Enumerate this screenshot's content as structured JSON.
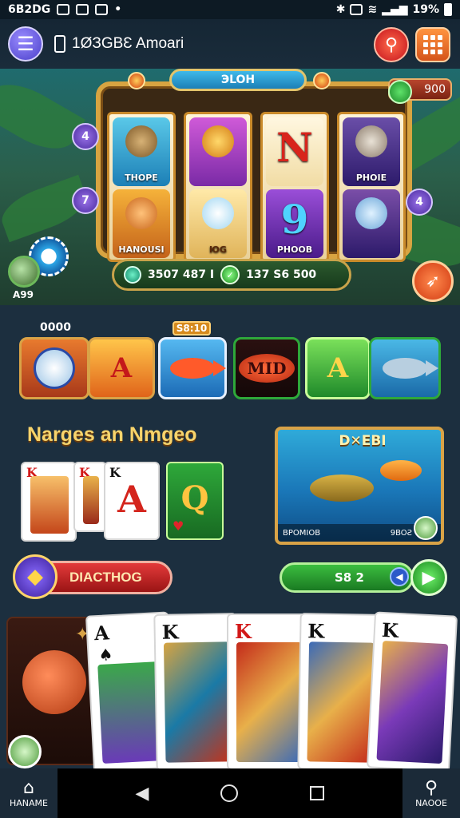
{
  "status_bar": {
    "time": "6B2DG",
    "battery": "19%"
  },
  "app_bar": {
    "title": "1ØЗGBƐ Amoari",
    "back_icon": "back-arrow-icon",
    "search_icon": "search-icon",
    "menu_icon": "grid-menu-icon"
  },
  "hero": {
    "marquee": "ЭLOH",
    "bet_value": "900",
    "left_level_1": "4",
    "left_level_2": "7",
    "right_level": "4",
    "player_tag": "A99",
    "reels": [
      {
        "top_label": "THOPE",
        "bottom_label": "HANOUSI"
      },
      {
        "top_label": "",
        "bottom_label": "ЮG"
      },
      {
        "top_letter": "N",
        "bottom_letter": "9",
        "bottom_label": "PHOOB"
      },
      {
        "top_label": "PHOIE",
        "bottom_label": ""
      }
    ],
    "balance_left": "3507 487 I",
    "balance_right": "137 S6 500"
  },
  "strip": {
    "label": "0000",
    "badge": "S8:10",
    "tiles": [
      {
        "name": "jester",
        "text": ""
      },
      {
        "name": "letter-a-gold",
        "text": "A"
      },
      {
        "name": "red-fish",
        "text": ""
      },
      {
        "name": "mid-disc",
        "text": "MID"
      },
      {
        "name": "letter-a-green",
        "text": "A"
      },
      {
        "name": "marlin",
        "text": ""
      }
    ]
  },
  "promo": {
    "title": "Narges an Nmgeo",
    "cards": [
      {
        "rank": "K",
        "color": "red"
      },
      {
        "rank": "K",
        "color": "red"
      },
      {
        "rank": "K",
        "color": "black"
      },
      {
        "rank": "Q",
        "color": "red"
      }
    ],
    "big_letter": "A",
    "ocean_title": "D✕EBI",
    "ocean_footer_left": "BPOMIOB",
    "ocean_footer_right": "9BOƧ"
  },
  "actions": {
    "diamond_label": "DIACTHOG",
    "play_value": "S8 2"
  },
  "fan_cards": [
    {
      "rank": "A",
      "suit": "♠",
      "color": "black"
    },
    {
      "rank": "K",
      "suit": "♠",
      "color": "black"
    },
    {
      "rank": "K",
      "suit": "♦",
      "color": "red"
    },
    {
      "rank": "K",
      "suit": "♠",
      "color": "black"
    },
    {
      "rank": "K",
      "suit": "♠",
      "color": "black"
    }
  ],
  "nav": {
    "home_label": "HANAME",
    "search_label": "NAOOE"
  },
  "colors": {
    "accent_gold": "#d9a347",
    "background": "#1c2f3f",
    "play_green": "#2ea83a",
    "alert_red": "#c4121c"
  }
}
